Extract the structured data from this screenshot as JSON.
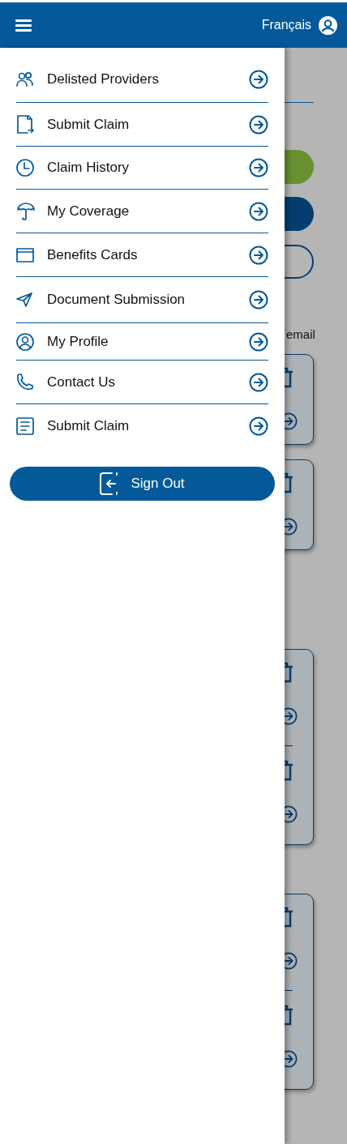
{
  "header": {
    "language": "Français"
  },
  "menu": [
    {
      "label": "Delisted Providers"
    },
    {
      "label": "Submit Claim"
    },
    {
      "label": "Claim History"
    },
    {
      "label": "My Coverage"
    },
    {
      "label": "Benefits Cards"
    },
    {
      "label": "Document Submission"
    },
    {
      "label": "My Profile"
    },
    {
      "label": "Contact Us"
    },
    {
      "label": "Submit Claim"
    }
  ],
  "sign_out": "Sign Out",
  "background": {
    "partial_text": "email"
  }
}
